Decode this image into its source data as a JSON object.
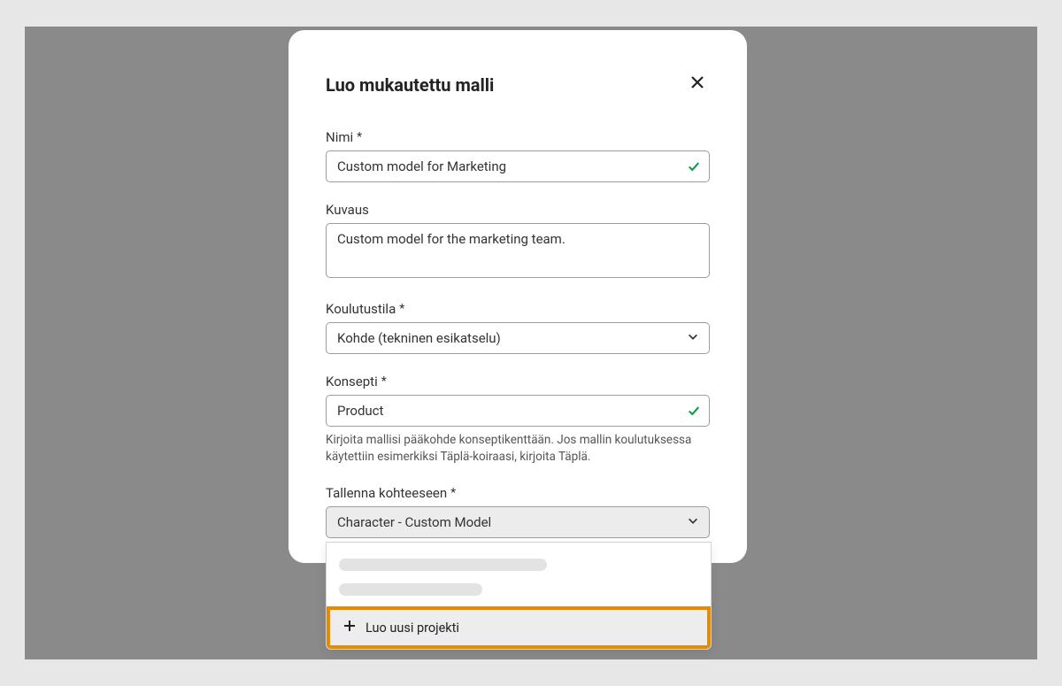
{
  "modal": {
    "title": "Luo mukautettu malli",
    "close_aria": "Close"
  },
  "fields": {
    "name": {
      "label": "Nimi",
      "required_marker": "*",
      "value": "Custom model for Marketing"
    },
    "description": {
      "label": "Kuvaus",
      "value": "Custom model for the marketing team."
    },
    "training_mode": {
      "label": "Koulutustila",
      "required_marker": "*",
      "value": "Kohde (tekninen esikatselu)"
    },
    "concept": {
      "label": "Konsepti",
      "required_marker": "*",
      "value": "Product",
      "help": "Kirjoita mallisi pääkohde konseptikenttään. Jos mallin koulutuksessa käytettiin esimerkiksi Täplä-koiraasi, kirjoita Täplä."
    },
    "save_to": {
      "label": "Tallenna kohteeseen",
      "required_marker": "*",
      "value": "Character - Custom Model"
    }
  },
  "dropdown": {
    "create_new_label": "Luo uusi projekti"
  }
}
